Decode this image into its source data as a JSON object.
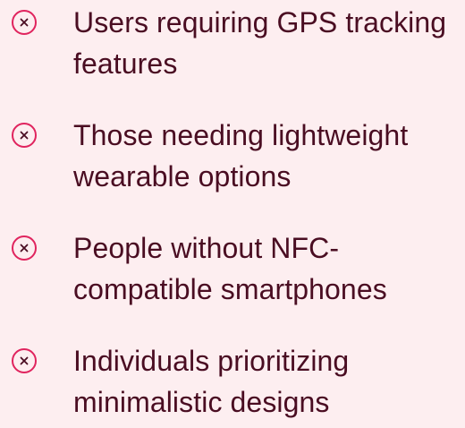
{
  "colors": {
    "background": "#fdeef0",
    "text": "#4a0d22",
    "icon_accent": "#e0245e"
  },
  "list": {
    "icon": "close-circle-icon",
    "items": [
      {
        "label": "Users requiring GPS tracking features"
      },
      {
        "label": "Those needing lightweight wearable options"
      },
      {
        "label": "People without NFC-compatible smartphones"
      },
      {
        "label": "Individuals prioritizing minimalistic designs"
      }
    ]
  }
}
